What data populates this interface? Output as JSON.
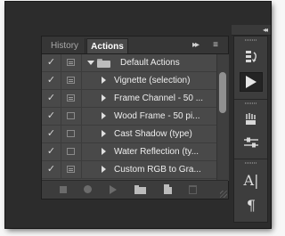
{
  "panel": {
    "tabs": [
      {
        "label": "History",
        "active": false
      },
      {
        "label": "Actions",
        "active": true
      }
    ],
    "collapse_glyph": "▸▸",
    "menu_glyph": "≡",
    "rows": [
      {
        "kind": "set",
        "label": "Default Actions",
        "checked": true,
        "dialog": true,
        "expanded": true
      },
      {
        "kind": "action",
        "label": "Vignette (selection)",
        "checked": true,
        "dialog": true
      },
      {
        "kind": "action",
        "label": "Frame Channel - 50 ...",
        "checked": true,
        "dialog": true
      },
      {
        "kind": "action",
        "label": "Wood Frame - 50 pi...",
        "checked": true,
        "dialog": false
      },
      {
        "kind": "action",
        "label": "Cast Shadow (type)",
        "checked": true,
        "dialog": false
      },
      {
        "kind": "action",
        "label": "Water Reflection (ty...",
        "checked": true,
        "dialog": false
      },
      {
        "kind": "action",
        "label": "Custom RGB to Gra...",
        "checked": true,
        "dialog": true
      }
    ],
    "check_glyph": "✓",
    "footer_buttons": [
      {
        "name": "stop-playing-button",
        "icon": "stop-icon",
        "enabled": false
      },
      {
        "name": "begin-recording-button",
        "icon": "record-icon",
        "enabled": false
      },
      {
        "name": "play-selection-button",
        "icon": "play-icon",
        "enabled": false
      },
      {
        "name": "create-new-set-button",
        "icon": "folder-icon",
        "enabled": true
      },
      {
        "name": "create-new-action-button",
        "icon": "new-document-icon",
        "enabled": true
      },
      {
        "name": "delete-button",
        "icon": "trash-icon",
        "enabled": false
      }
    ]
  },
  "dock": {
    "collapse_glyph": "◂◂",
    "buttons": [
      {
        "name": "history-panel-button",
        "icon": "history-icon",
        "active": false
      },
      {
        "name": "actions-panel-button",
        "icon": "play-icon",
        "active": true
      },
      {
        "name": "brush-panel-button",
        "icon": "brush-icon",
        "active": false
      },
      {
        "name": "adjustments-panel-button",
        "icon": "sliders-icon",
        "active": false
      },
      {
        "name": "character-panel-button",
        "icon": "character-icon",
        "glyph": "A|",
        "active": false
      },
      {
        "name": "paragraph-panel-button",
        "icon": "paragraph-icon",
        "glyph": "¶",
        "active": false
      }
    ]
  },
  "colors": {
    "workspace": "#2c2c2c",
    "panel_body": "#494949",
    "text": "#eeeeee"
  }
}
